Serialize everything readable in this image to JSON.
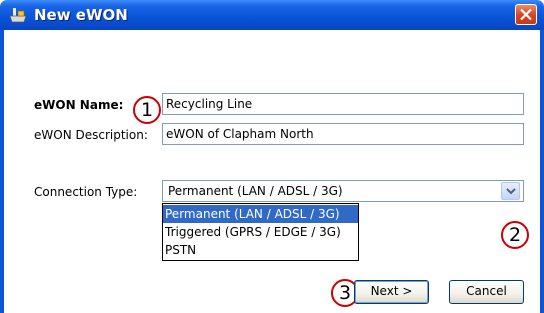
{
  "window": {
    "title": "New eWON",
    "app_icon": "ewon-app-icon",
    "close_icon": "close-icon",
    "close_color": "#d8431e",
    "titlebar_color": "#0a55d8"
  },
  "form": {
    "name_label": "eWON Name:",
    "name_value": "Recycling Line",
    "description_label": "eWON Description:",
    "description_value": "eWON of Clapham North",
    "connection_label": "Connection Type:",
    "connection_value": "Permanent (LAN / ADSL / 3G)",
    "connection_options": [
      "Permanent (LAN / ADSL / 3G)",
      "Triggered (GPRS / EDGE / 3G)",
      "PSTN"
    ],
    "selected_option_index": 0
  },
  "callouts": [
    "1",
    "2",
    "3"
  ],
  "buttons": {
    "next_label": "Next >",
    "cancel_label": "Cancel"
  }
}
